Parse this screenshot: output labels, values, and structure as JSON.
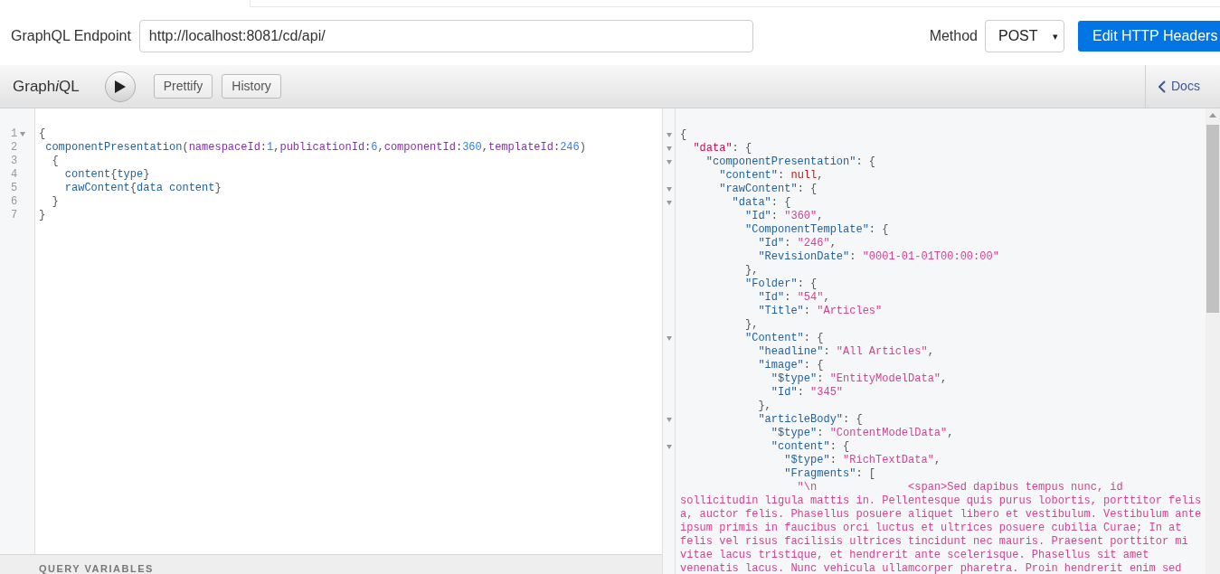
{
  "endpoint": {
    "label": "GraphQL Endpoint",
    "value": "http://localhost:8081/cd/api/"
  },
  "method": {
    "label": "Method",
    "value": "POST",
    "caret": "▾"
  },
  "headers_button": "Edit HTTP Headers",
  "toolbar": {
    "title": "Graph",
    "title_italic": "i",
    "title_end": "QL",
    "buttons": [
      "Prettify",
      "History"
    ],
    "docs": "Docs"
  },
  "query": {
    "lines": [
      {
        "number": "1",
        "fold": true,
        "tokens": [
          {
            "kind": "punct",
            "text": "{"
          }
        ]
      },
      {
        "number": "2",
        "fold": false,
        "tokens": [
          {
            "kind": "field",
            "text": " componentPresentation"
          },
          {
            "kind": "punct",
            "text": "("
          },
          {
            "kind": "arg",
            "text": "namespaceId"
          },
          {
            "kind": "punct",
            "text": ":"
          },
          {
            "kind": "num",
            "text": "1"
          },
          {
            "kind": "punct",
            "text": ","
          },
          {
            "kind": "arg",
            "text": "publicationId"
          },
          {
            "kind": "punct",
            "text": ":"
          },
          {
            "kind": "num",
            "text": "6"
          },
          {
            "kind": "punct",
            "text": ","
          },
          {
            "kind": "arg",
            "text": "componentId"
          },
          {
            "kind": "punct",
            "text": ":"
          },
          {
            "kind": "num",
            "text": "360"
          },
          {
            "kind": "punct",
            "text": ","
          },
          {
            "kind": "arg",
            "text": "templateId"
          },
          {
            "kind": "punct",
            "text": ":"
          },
          {
            "kind": "num",
            "text": "246"
          },
          {
            "kind": "punct",
            "text": ")"
          }
        ]
      },
      {
        "number": "3",
        "fold": false,
        "tokens": [
          {
            "kind": "punct",
            "text": "  {"
          }
        ]
      },
      {
        "number": "4",
        "fold": false,
        "tokens": [
          {
            "kind": "field",
            "text": "    content"
          },
          {
            "kind": "punct",
            "text": "{"
          },
          {
            "kind": "field",
            "text": "type"
          },
          {
            "kind": "punct",
            "text": "}"
          }
        ]
      },
      {
        "number": "5",
        "fold": false,
        "tokens": [
          {
            "kind": "field",
            "text": "    rawContent"
          },
          {
            "kind": "punct",
            "text": "{"
          },
          {
            "kind": "field",
            "text": "data content"
          },
          {
            "kind": "punct",
            "text": "}"
          }
        ]
      },
      {
        "number": "6",
        "fold": false,
        "tokens": [
          {
            "kind": "punct",
            "text": "  }"
          }
        ]
      },
      {
        "number": "7",
        "fold": false,
        "tokens": [
          {
            "kind": "punct",
            "text": "}"
          }
        ]
      }
    ],
    "variables_title": "QUERY VARIABLES"
  },
  "result": {
    "lines": [
      {
        "fold": true,
        "tokens": [
          {
            "kind": "punct",
            "text": "{"
          }
        ]
      },
      {
        "fold": true,
        "tokens": [
          {
            "kind": "root",
            "text": "  \"data\""
          },
          {
            "kind": "punct",
            "text": ": {"
          }
        ]
      },
      {
        "fold": true,
        "tokens": [
          {
            "kind": "key",
            "text": "    \"componentPresentation\""
          },
          {
            "kind": "punct",
            "text": ": {"
          }
        ]
      },
      {
        "fold": false,
        "tokens": [
          {
            "kind": "key",
            "text": "      \"content\""
          },
          {
            "kind": "punct",
            "text": ": "
          },
          {
            "kind": "null",
            "text": "null"
          },
          {
            "kind": "punct",
            "text": ","
          }
        ]
      },
      {
        "fold": true,
        "tokens": [
          {
            "kind": "key",
            "text": "      \"rawContent\""
          },
          {
            "kind": "punct",
            "text": ": {"
          }
        ]
      },
      {
        "fold": true,
        "tokens": [
          {
            "kind": "key",
            "text": "        \"data\""
          },
          {
            "kind": "punct",
            "text": ": {"
          }
        ]
      },
      {
        "fold": false,
        "tokens": [
          {
            "kind": "key",
            "text": "          \"Id\""
          },
          {
            "kind": "punct",
            "text": ": "
          },
          {
            "kind": "str",
            "text": "\"360\""
          },
          {
            "kind": "punct",
            "text": ","
          }
        ]
      },
      {
        "fold": false,
        "tokens": [
          {
            "kind": "key",
            "text": "          \"ComponentTemplate\""
          },
          {
            "kind": "punct",
            "text": ": {"
          }
        ]
      },
      {
        "fold": false,
        "tokens": [
          {
            "kind": "key",
            "text": "            \"Id\""
          },
          {
            "kind": "punct",
            "text": ": "
          },
          {
            "kind": "str",
            "text": "\"246\""
          },
          {
            "kind": "punct",
            "text": ","
          }
        ]
      },
      {
        "fold": false,
        "tokens": [
          {
            "kind": "key",
            "text": "            \"RevisionDate\""
          },
          {
            "kind": "punct",
            "text": ": "
          },
          {
            "kind": "str",
            "text": "\"0001-01-01T00:00:00\""
          }
        ]
      },
      {
        "fold": false,
        "tokens": [
          {
            "kind": "punct",
            "text": "          },"
          }
        ]
      },
      {
        "fold": false,
        "tokens": [
          {
            "kind": "key",
            "text": "          \"Folder\""
          },
          {
            "kind": "punct",
            "text": ": {"
          }
        ]
      },
      {
        "fold": false,
        "tokens": [
          {
            "kind": "key",
            "text": "            \"Id\""
          },
          {
            "kind": "punct",
            "text": ": "
          },
          {
            "kind": "str",
            "text": "\"54\""
          },
          {
            "kind": "punct",
            "text": ","
          }
        ]
      },
      {
        "fold": false,
        "tokens": [
          {
            "kind": "key",
            "text": "            \"Title\""
          },
          {
            "kind": "punct",
            "text": ": "
          },
          {
            "kind": "str",
            "text": "\"Articles\""
          }
        ]
      },
      {
        "fold": false,
        "tokens": [
          {
            "kind": "punct",
            "text": "          },"
          }
        ]
      },
      {
        "fold": true,
        "tokens": [
          {
            "kind": "key",
            "text": "          \"Content\""
          },
          {
            "kind": "punct",
            "text": ": {"
          }
        ]
      },
      {
        "fold": false,
        "tokens": [
          {
            "kind": "key",
            "text": "            \"headline\""
          },
          {
            "kind": "punct",
            "text": ": "
          },
          {
            "kind": "str",
            "text": "\"All Articles\""
          },
          {
            "kind": "punct",
            "text": ","
          }
        ]
      },
      {
        "fold": false,
        "tokens": [
          {
            "kind": "key",
            "text": "            \"image\""
          },
          {
            "kind": "punct",
            "text": ": {"
          }
        ]
      },
      {
        "fold": false,
        "tokens": [
          {
            "kind": "key",
            "text": "              \"$type\""
          },
          {
            "kind": "punct",
            "text": ": "
          },
          {
            "kind": "str",
            "text": "\"EntityModelData\""
          },
          {
            "kind": "punct",
            "text": ","
          }
        ]
      },
      {
        "fold": false,
        "tokens": [
          {
            "kind": "key",
            "text": "              \"Id\""
          },
          {
            "kind": "punct",
            "text": ": "
          },
          {
            "kind": "str",
            "text": "\"345\""
          }
        ]
      },
      {
        "fold": false,
        "tokens": [
          {
            "kind": "punct",
            "text": "            },"
          }
        ]
      },
      {
        "fold": true,
        "tokens": [
          {
            "kind": "key",
            "text": "            \"articleBody\""
          },
          {
            "kind": "punct",
            "text": ": {"
          }
        ]
      },
      {
        "fold": false,
        "tokens": [
          {
            "kind": "key",
            "text": "              \"$type\""
          },
          {
            "kind": "punct",
            "text": ": "
          },
          {
            "kind": "str",
            "text": "\"ContentModelData\""
          },
          {
            "kind": "punct",
            "text": ","
          }
        ]
      },
      {
        "fold": true,
        "tokens": [
          {
            "kind": "key",
            "text": "              \"content\""
          },
          {
            "kind": "punct",
            "text": ": {"
          }
        ]
      },
      {
        "fold": false,
        "tokens": [
          {
            "kind": "key",
            "text": "                \"$type\""
          },
          {
            "kind": "punct",
            "text": ": "
          },
          {
            "kind": "str",
            "text": "\"RichTextData\""
          },
          {
            "kind": "punct",
            "text": ","
          }
        ]
      },
      {
        "fold": false,
        "tokens": [
          {
            "kind": "key",
            "text": "                \"Fragments\""
          },
          {
            "kind": "punct",
            "text": ": ["
          }
        ]
      },
      {
        "fold": false,
        "tokens": [
          {
            "kind": "str",
            "text": "                  \"\\n              <span>Sed dapibus tempus nunc, id"
          }
        ]
      },
      {
        "fold": false,
        "tokens": [
          {
            "kind": "str",
            "text": "sollicitudin ligula mattis in. Pellentesque quis purus lobortis, porttitor felis"
          }
        ]
      },
      {
        "fold": false,
        "tokens": [
          {
            "kind": "str",
            "text": "a, auctor felis. Phasellus posuere aliquet libero et vestibulum. Vestibulum ante"
          }
        ]
      },
      {
        "fold": false,
        "tokens": [
          {
            "kind": "str",
            "text": "ipsum primis in faucibus orci luctus et ultrices posuere cubilia Curae; In at"
          }
        ]
      },
      {
        "fold": false,
        "tokens": [
          {
            "kind": "str",
            "text": "felis vel risus facilisis ultrices tincidunt nec mauris. Praesent porttitor mi"
          }
        ]
      },
      {
        "fold": false,
        "tokens": [
          {
            "kind": "str",
            "text": "vitae lacus tristique, et hendrerit ante scelerisque. Phasellus sit amet"
          }
        ]
      },
      {
        "fold": false,
        "tokens": [
          {
            "kind": "str",
            "text": "venenatis lacus. Nunc vehicula ullamcorper pharetra. Proin hendrerit enim sed"
          }
        ]
      }
    ]
  }
}
